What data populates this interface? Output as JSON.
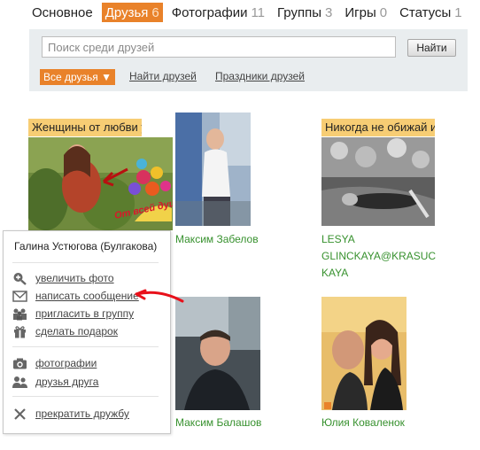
{
  "tabs": [
    {
      "label": "Основное",
      "count": ""
    },
    {
      "label": "Друзья",
      "count": "6",
      "active": true
    },
    {
      "label": "Фотографии",
      "count": "11"
    },
    {
      "label": "Группы",
      "count": "3"
    },
    {
      "label": "Игры",
      "count": "0"
    },
    {
      "label": "Статусы",
      "count": "1"
    }
  ],
  "search": {
    "placeholder": "Поиск среди друзей",
    "button": "Найти"
  },
  "filters": {
    "all_friends": "Все друзья ▼",
    "find_friends": "Найти друзей",
    "holidays": "Праздники друзей"
  },
  "friends": [
    {
      "caption": "Женщины от любви у",
      "sticker_text": "От всей души!"
    },
    {
      "name": "Максим Забелов"
    },
    {
      "caption": "Никогда не обижай и",
      "name_lines": [
        "LESYA",
        "GLINCKAYA@KRASUC",
        "KAYA"
      ]
    },
    {
      "name": "Максим Балашов"
    },
    {
      "name": "Юлия Коваленок"
    }
  ],
  "popup": {
    "person_name": "Галина Устюгова (Булгакова)",
    "items": [
      {
        "label": "увеличить фото",
        "icon": "zoom-plus-icon"
      },
      {
        "label": "написать сообщение",
        "icon": "envelope-icon"
      },
      {
        "label": "пригласить в группу",
        "icon": "people-group-icon"
      },
      {
        "label": "сделать подарок",
        "icon": "gift-icon"
      },
      {
        "label": "фотографии",
        "icon": "camera-icon"
      },
      {
        "label": "друзья друга",
        "icon": "friends-icon"
      },
      {
        "label": "прекратить дружбу",
        "icon": "cross-icon"
      }
    ]
  },
  "colors": {
    "accent": "#e9822a",
    "link_green": "#37912e",
    "caption_bg": "#f7cd74",
    "panel_bg": "#e9edef",
    "annotation_red": "#e8101a"
  }
}
